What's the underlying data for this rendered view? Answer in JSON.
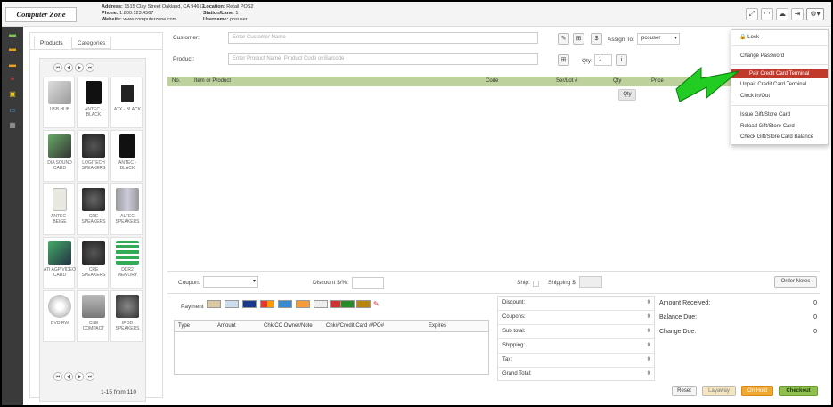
{
  "header": {
    "logo_text": "Computer Zone",
    "address": "1515 Clay Street Oakland, CA 94612",
    "phone": "1.800.123.4567",
    "website": "www.computerzone.com",
    "location": "Retail POS2",
    "station": "1",
    "username": "posuser",
    "labels": {
      "address": "Address:",
      "phone": "Phone:",
      "website": "Website:",
      "location": "Location:",
      "station": "Station/Lane:",
      "username": "Username:"
    },
    "icons": [
      "expand-icon",
      "wifi-icon",
      "cloud-icon",
      "logout-icon",
      "gear-icon"
    ]
  },
  "products_panel": {
    "tabs": [
      "Products",
      "Categories"
    ],
    "items": [
      "USB HUB",
      "ANTEC - BLACK",
      "ATX - BLACK",
      "DIA SOUND CARD",
      "LOGITECH SPEAKERS",
      "ANTEC - BLACK",
      "ANTEC - BEIGE",
      "CRE SPEAKERS",
      "ALTEC SPEAKERS",
      "ATI AGP VIDEO CARD",
      "CRE SPEAKERS",
      "DDR2 MEMORY",
      "DVD RW",
      "CHE COMPACT",
      "IPOD SPEAKERS"
    ],
    "pager_text": "1-15 from 110"
  },
  "form": {
    "customer_label": "Customer:",
    "customer_placeholder": "Enter Customer Name",
    "assign_label": "Assign To:",
    "assign_value": "posuser",
    "product_label": "Product:",
    "product_placeholder": "Enter Product Name, Product Code or Barcode",
    "qty_label": "Qty:",
    "qty_value": "1",
    "customer_buttons": [
      "edit-icon",
      "add-icon",
      "dollar-icon"
    ],
    "dollar_glyph": "$",
    "info_glyph": "i"
  },
  "items_table": {
    "columns": [
      "No.",
      "Item or Product",
      "Code",
      "Ser/Lot #",
      "Qty",
      "Price"
    ],
    "tooltip": "Qty"
  },
  "bottom": {
    "coupon_label": "Coupon:",
    "discount_label": "Discount $/%:",
    "ship_label": "Ship:",
    "shipping_label": "Shipping $:",
    "order_notes_label": "Order Notes",
    "payment_label": "Payment",
    "payment_columns": [
      "Type",
      "Amount",
      "Chk/CC Owner/Note",
      "Chk#/Credit Card #/PO#",
      "Expires"
    ],
    "payment_methods": [
      "cash",
      "check",
      "visa",
      "mastercard",
      "amex",
      "discover",
      "gift",
      "store-credit",
      "account",
      "on-credit",
      "pen"
    ],
    "summary": [
      {
        "label": "Discount:",
        "value": "0"
      },
      {
        "label": "Coupons:",
        "value": "0"
      },
      {
        "label": "Sub total:",
        "value": "0"
      },
      {
        "label": "Shipping:",
        "value": "0"
      },
      {
        "label": "Tax:",
        "value": "0"
      },
      {
        "label": "Grand Total:",
        "value": "0"
      }
    ],
    "received": [
      {
        "label": "Amount Received:",
        "value": "0"
      },
      {
        "label": "Balance Due:",
        "value": "0"
      },
      {
        "label": "Change Due:",
        "value": "0"
      }
    ]
  },
  "footer_buttons": {
    "reset": "Reset",
    "layaway": "Layaway",
    "on_hold": "On Hold",
    "checkout": "Checkout"
  },
  "settings_menu": {
    "lock": "Lock",
    "change_password": "Change Password",
    "pair": "Pair Credit Card Terminal",
    "unpair": "Unpair Credit Card Terminal",
    "clock": "Clock In/Out",
    "issue_gift": "Issue Gift/Store Card",
    "reload_gift": "Reload Gift/Store Card",
    "check_gift": "Check Gift/Store Card Balance"
  },
  "colors": {
    "accent_green": "#bcd19b",
    "menu_highlight": "#c0392b",
    "arrow_green": "#22cc22",
    "checkout": "#8fbf4d",
    "on_hold": "#f0a830"
  }
}
